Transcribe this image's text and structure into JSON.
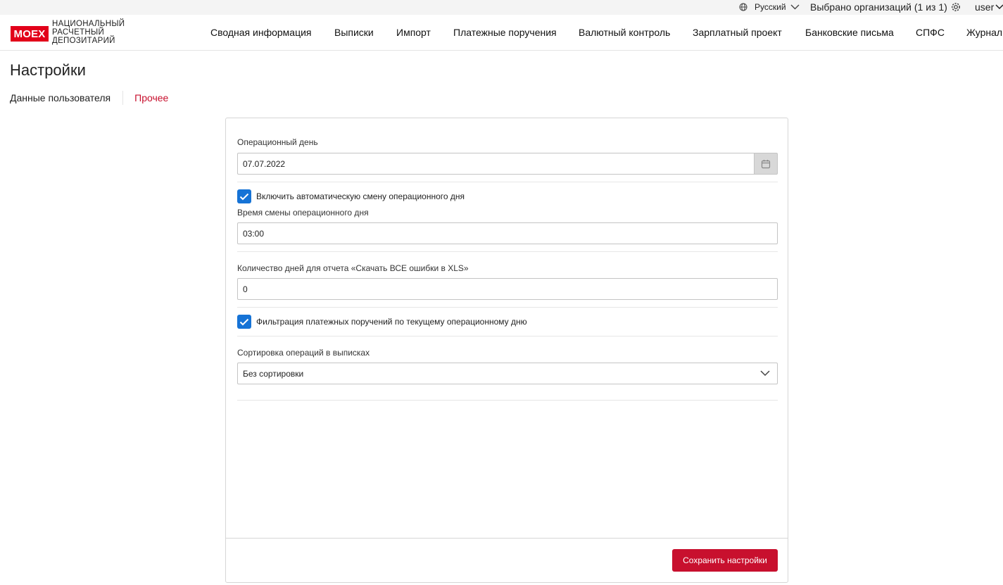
{
  "topbar": {
    "language": "Русский",
    "orgs": "Выбрано организаций (1 из 1)",
    "user": "user"
  },
  "logo": {
    "brand": "MOEX",
    "line1": "НАЦИОНАЛЬНЫЙ",
    "line2": "РАСЧЕТНЫЙ",
    "line3": "ДЕПОЗИТАРИЙ"
  },
  "nav": {
    "items": [
      "Сводная информация",
      "Выписки",
      "Импорт",
      "Платежные поручения",
      "Валютный контроль",
      "Зарплатный проект",
      "Банковские письма",
      "СПФС",
      "Журнал"
    ]
  },
  "page": {
    "title": "Настройки",
    "tabs": [
      "Данные пользователя",
      "Прочее"
    ]
  },
  "form": {
    "op_day_label": "Операционный день",
    "op_day_value": "07.07.2022",
    "auto_change_label": "Включить автоматическую смену операционного дня",
    "auto_change_checked": true,
    "change_time_label": "Время смены операционного дня",
    "change_time_value": "03:00",
    "days_label": "Количество дней для отчета «Скачать ВСЕ ошибки в XLS»",
    "days_value": "0",
    "filter_label": "Фильтрация платежных поручений по текущему операционному дню",
    "filter_checked": true,
    "sort_label": "Сортировка операций в выписках",
    "sort_value": "Без сортировки",
    "save_label": "Сохранить настройки"
  },
  "colors": {
    "accent": "#c8102e",
    "checkbox": "#1673d6"
  }
}
